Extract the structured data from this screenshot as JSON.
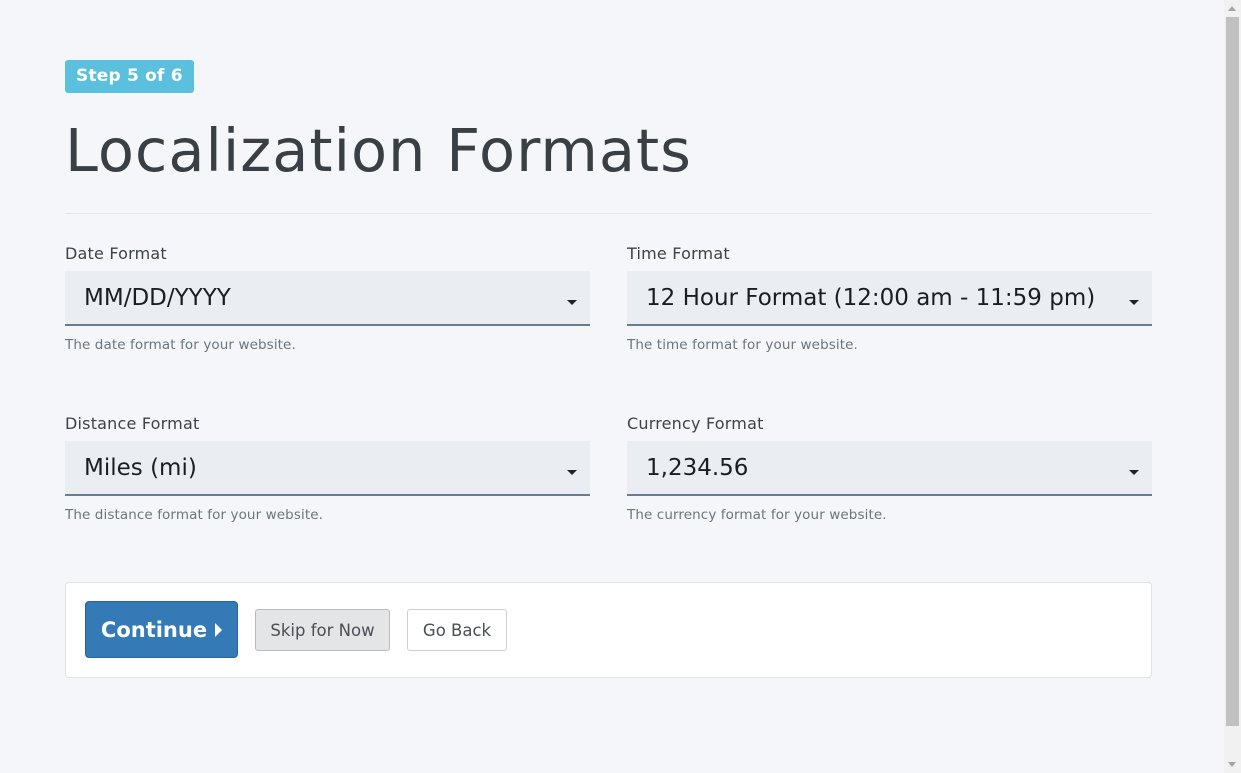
{
  "step_badge": "Step 5 of 6",
  "title": "Localization Formats",
  "fields": {
    "date": {
      "label": "Date Format",
      "value": "MM/DD/YYYY",
      "help": "The date format for your website."
    },
    "time": {
      "label": "Time Format",
      "value": "12 Hour Format (12:00 am - 11:59 pm)",
      "help": "The time format for your website."
    },
    "distance": {
      "label": "Distance Format",
      "value": "Miles (mi)",
      "help": "The distance format for your website."
    },
    "currency": {
      "label": "Currency Format",
      "value": "1,234.56",
      "help": "The currency format for your website."
    }
  },
  "actions": {
    "continue_label": "Continue",
    "skip_label": "Skip for Now",
    "back_label": "Go Back"
  },
  "colors": {
    "badge": "#5bc0de",
    "primary_button": "#337ab7",
    "background": "#f4f6fa",
    "select_background": "#eaedf1"
  }
}
